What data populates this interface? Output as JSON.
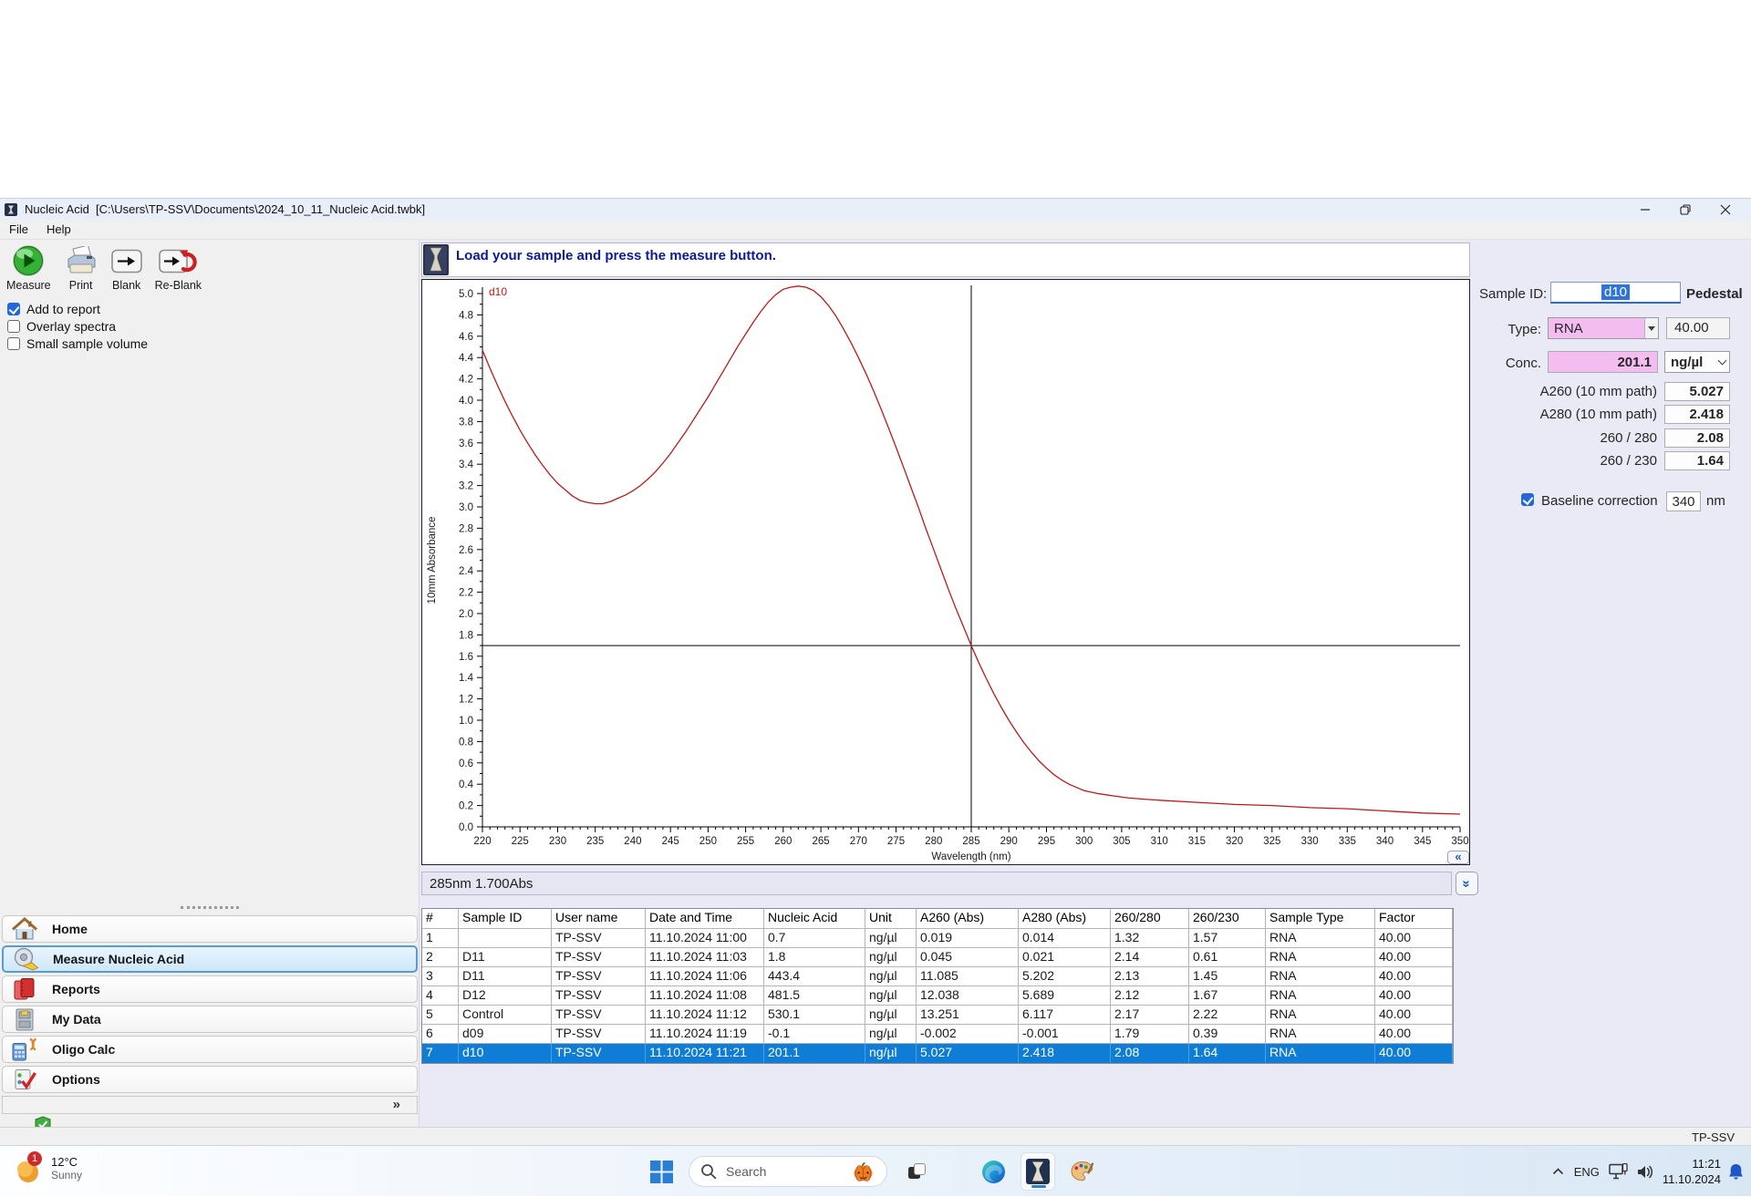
{
  "window": {
    "title": "Nucleic Acid  [C:\\Users\\TP-SSV\\Documents\\2024_10_11_Nucleic Acid.twbk]",
    "menu": [
      "File",
      "Help"
    ],
    "status_user": "TP-SSV"
  },
  "toolbar": {
    "buttons": [
      {
        "name": "measure-button",
        "icon": "measure-icon",
        "label": "Measure"
      },
      {
        "name": "print-button",
        "icon": "print-icon",
        "label": "Print"
      },
      {
        "name": "blank-button",
        "icon": "blank-icon",
        "label": "Blank"
      },
      {
        "name": "reblank-button",
        "icon": "reblank-icon",
        "label": "Re-Blank"
      }
    ]
  },
  "options": [
    {
      "label": "Add to report",
      "checked": true
    },
    {
      "label": "Overlay spectra",
      "checked": false
    },
    {
      "label": "Small sample volume",
      "checked": false
    }
  ],
  "sidebar": {
    "items": [
      {
        "label": "Home",
        "icon": "home-icon",
        "selected": false
      },
      {
        "label": "Measure Nucleic Acid",
        "icon": "measuring-tape-icon",
        "selected": true
      },
      {
        "label": "Reports",
        "icon": "reports-icon",
        "selected": false
      },
      {
        "label": "My Data",
        "icon": "file-cabinet-icon",
        "selected": false
      },
      {
        "label": "Oligo Calc",
        "icon": "oligo-calc-icon",
        "selected": false
      },
      {
        "label": "Options",
        "icon": "options-icon",
        "selected": false
      }
    ],
    "collapse_glyph": "»"
  },
  "message": "Load your sample and press the measure button.",
  "chart_controls": {
    "collapse_glyph": "«",
    "expand_glyph": "»"
  },
  "cursor_readout": "285nm 1.700Abs",
  "sample_panel": {
    "sample_id_label": "Sample ID:",
    "sample_id": "d10",
    "mode": "Pedestal",
    "type_label": "Type:",
    "type_value": "RNA",
    "factor_value": "40.00",
    "conc_label": "Conc.",
    "conc_value": "201.1",
    "conc_unit": "ng/µl",
    "rows": [
      {
        "label": "A260 (10 mm path)",
        "value": "5.027"
      },
      {
        "label": "A280 (10 mm path)",
        "value": "2.418"
      },
      {
        "label": "260 / 280",
        "value": "2.08"
      },
      {
        "label": "260 / 230",
        "value": "1.64"
      }
    ],
    "baseline": {
      "label": "Baseline correction",
      "checked": true,
      "value": "340",
      "unit": "nm"
    }
  },
  "chart_data": {
    "type": "line",
    "xlabel": "Wavelength (nm)",
    "ylabel": "10mm Absorbance",
    "xlim": [
      220,
      350
    ],
    "ylim": [
      0.0,
      5.0
    ],
    "x_tick_step": 5,
    "x_minor_step": 1,
    "y_tick_step": 0.2,
    "y_minor_step": 0.1,
    "grid": false,
    "crosshair": {
      "x": 285,
      "y": 1.7
    },
    "series": [
      {
        "name": "d10",
        "color": "#c01818",
        "points": [
          [
            220,
            4.47
          ],
          [
            221,
            4.3
          ],
          [
            222,
            4.14
          ],
          [
            223,
            3.99
          ],
          [
            224,
            3.85
          ],
          [
            225,
            3.72
          ],
          [
            226,
            3.6
          ],
          [
            227,
            3.49
          ],
          [
            228,
            3.39
          ],
          [
            229,
            3.3
          ],
          [
            230,
            3.22
          ],
          [
            231,
            3.16
          ],
          [
            232,
            3.1
          ],
          [
            233,
            3.06
          ],
          [
            234,
            3.04
          ],
          [
            235,
            3.03
          ],
          [
            236,
            3.03
          ],
          [
            237,
            3.05
          ],
          [
            238,
            3.08
          ],
          [
            239,
            3.11
          ],
          [
            240,
            3.15
          ],
          [
            241,
            3.2
          ],
          [
            242,
            3.26
          ],
          [
            243,
            3.33
          ],
          [
            244,
            3.41
          ],
          [
            245,
            3.5
          ],
          [
            246,
            3.6
          ],
          [
            247,
            3.7
          ],
          [
            248,
            3.81
          ],
          [
            249,
            3.92
          ],
          [
            250,
            4.03
          ],
          [
            251,
            4.15
          ],
          [
            252,
            4.27
          ],
          [
            253,
            4.39
          ],
          [
            254,
            4.51
          ],
          [
            255,
            4.62
          ],
          [
            256,
            4.73
          ],
          [
            257,
            4.83
          ],
          [
            258,
            4.92
          ],
          [
            259,
            4.99
          ],
          [
            260,
            5.04
          ],
          [
            261,
            5.06
          ],
          [
            262,
            5.07
          ],
          [
            263,
            5.06
          ],
          [
            264,
            5.03
          ],
          [
            265,
            4.97
          ],
          [
            266,
            4.89
          ],
          [
            267,
            4.79
          ],
          [
            268,
            4.67
          ],
          [
            269,
            4.54
          ],
          [
            270,
            4.4
          ],
          [
            271,
            4.25
          ],
          [
            272,
            4.09
          ],
          [
            273,
            3.92
          ],
          [
            274,
            3.74
          ],
          [
            275,
            3.56
          ],
          [
            276,
            3.37
          ],
          [
            277,
            3.18
          ],
          [
            278,
            2.99
          ],
          [
            279,
            2.79
          ],
          [
            280,
            2.6
          ],
          [
            281,
            2.41
          ],
          [
            282,
            2.22
          ],
          [
            283,
            2.04
          ],
          [
            284,
            1.87
          ],
          [
            285,
            1.7
          ],
          [
            286,
            1.54
          ],
          [
            287,
            1.39
          ],
          [
            288,
            1.25
          ],
          [
            289,
            1.12
          ],
          [
            290,
            1.0
          ],
          [
            291,
            0.89
          ],
          [
            292,
            0.79
          ],
          [
            293,
            0.7
          ],
          [
            294,
            0.62
          ],
          [
            295,
            0.55
          ],
          [
            296,
            0.49
          ],
          [
            297,
            0.44
          ],
          [
            298,
            0.4
          ],
          [
            299,
            0.37
          ],
          [
            300,
            0.34
          ],
          [
            302,
            0.31
          ],
          [
            304,
            0.29
          ],
          [
            306,
            0.27
          ],
          [
            308,
            0.26
          ],
          [
            310,
            0.25
          ],
          [
            315,
            0.23
          ],
          [
            320,
            0.21
          ],
          [
            325,
            0.2
          ],
          [
            330,
            0.18
          ],
          [
            335,
            0.17
          ],
          [
            340,
            0.15
          ],
          [
            345,
            0.13
          ],
          [
            350,
            0.12
          ]
        ]
      }
    ]
  },
  "table": {
    "headers": [
      "#",
      "Sample ID",
      "User name",
      "Date and Time",
      "Nucleic Acid",
      "Unit",
      "A260 (Abs)",
      "A280 (Abs)",
      "260/280",
      "260/230",
      "Sample Type",
      "Factor"
    ],
    "rows": [
      [
        "1",
        "",
        "TP-SSV",
        "11.10.2024 11:00",
        "0.7",
        "ng/µl",
        "0.019",
        "0.014",
        "1.32",
        "1.57",
        "RNA",
        "40.00"
      ],
      [
        "2",
        "D11",
        "TP-SSV",
        "11.10.2024 11:03",
        "1.8",
        "ng/µl",
        "0.045",
        "0.021",
        "2.14",
        "0.61",
        "RNA",
        "40.00"
      ],
      [
        "3",
        "D11",
        "TP-SSV",
        "11.10.2024 11:06",
        "443.4",
        "ng/µl",
        "11.085",
        "5.202",
        "2.13",
        "1.45",
        "RNA",
        "40.00"
      ],
      [
        "4",
        "D12",
        "TP-SSV",
        "11.10.2024 11:08",
        "481.5",
        "ng/µl",
        "12.038",
        "5.689",
        "2.12",
        "1.67",
        "RNA",
        "40.00"
      ],
      [
        "5",
        "Control",
        "TP-SSV",
        "11.10.2024 11:12",
        "530.1",
        "ng/µl",
        "13.251",
        "6.117",
        "2.17",
        "2.22",
        "RNA",
        "40.00"
      ],
      [
        "6",
        "d09",
        "TP-SSV",
        "11.10.2024 11:19",
        "-0.1",
        "ng/µl",
        "-0.002",
        "-0.001",
        "1.79",
        "0.39",
        "RNA",
        "40.00"
      ],
      [
        "7",
        "d10",
        "TP-SSV",
        "11.10.2024 11:21",
        "201.1",
        "ng/µl",
        "5.027",
        "2.418",
        "2.08",
        "1.64",
        "RNA",
        "40.00"
      ]
    ],
    "selected_row_index": 6
  },
  "taskbar": {
    "weather": {
      "temp": "12°C",
      "condition": "Sunny",
      "badge": "1"
    },
    "search_placeholder": "Search",
    "tray": {
      "lang": "ENG",
      "time": "11:21",
      "date": "11.10.2024"
    }
  }
}
